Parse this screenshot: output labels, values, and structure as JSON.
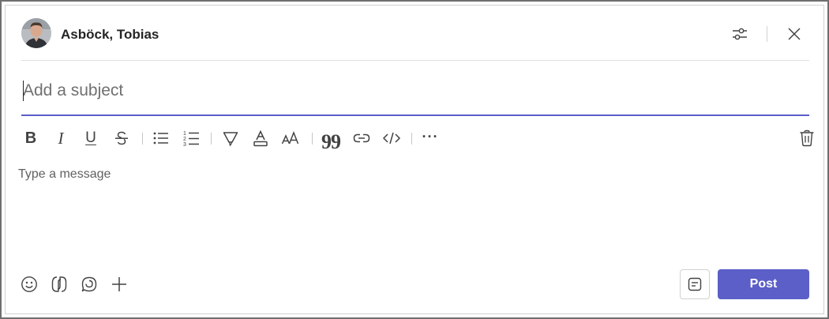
{
  "header": {
    "author_name": "Asböck, Tobias",
    "options_icon": "sliders-icon",
    "close_icon": "close-icon"
  },
  "subject": {
    "placeholder": "Add a subject",
    "value": ""
  },
  "toolbar": {
    "items": [
      "bold",
      "italic",
      "underline",
      "strikethrough",
      "bulleted-list",
      "numbered-list",
      "highlight",
      "font-color",
      "font-size",
      "quote",
      "link",
      "code",
      "more"
    ],
    "bold_glyph": "B",
    "italic_glyph": "I",
    "underline_glyph": "U",
    "quote_glyph": "99",
    "more_glyph": "···",
    "delete_icon": "trash-icon"
  },
  "message": {
    "placeholder": "Type a message"
  },
  "bottom": {
    "actions": [
      "emoji-icon",
      "loop-icon",
      "copilot-chat-icon",
      "plus-icon"
    ],
    "format_icon": "format-icon",
    "post_label": "Post"
  },
  "colors": {
    "accent": "#5b5fc7",
    "text": "#242424",
    "placeholder": "#616161",
    "border": "#d1d1d1"
  }
}
